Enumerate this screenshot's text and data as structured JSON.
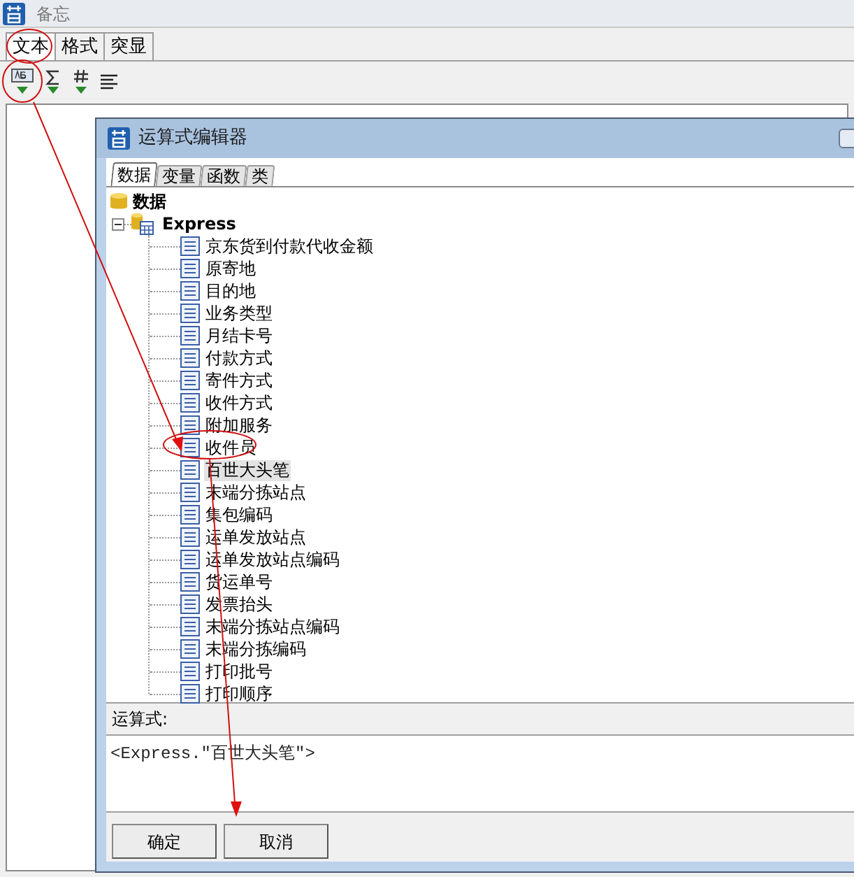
{
  "window": {
    "title": "备忘"
  },
  "tabs": [
    {
      "label": "文本",
      "selected": true
    },
    {
      "label": "格式",
      "selected": false
    },
    {
      "label": "突显",
      "selected": false
    }
  ],
  "dialog": {
    "title": "运算式编辑器",
    "tabs": [
      {
        "label": "数据",
        "selected": true
      },
      {
        "label": "变量",
        "selected": false
      },
      {
        "label": "函数",
        "selected": false
      },
      {
        "label": "类",
        "selected": false
      }
    ],
    "tree": {
      "label": "数据",
      "children": [
        {
          "label": "Express",
          "expanded": true,
          "children": [
            {
              "label": "京东货到付款代收金额",
              "selected": false
            },
            {
              "label": "原寄地",
              "selected": false
            },
            {
              "label": "目的地",
              "selected": false
            },
            {
              "label": "业务类型",
              "selected": false
            },
            {
              "label": "月结卡号",
              "selected": false
            },
            {
              "label": "付款方式",
              "selected": false
            },
            {
              "label": "寄件方式",
              "selected": false
            },
            {
              "label": "收件方式",
              "selected": false
            },
            {
              "label": "附加服务",
              "selected": false
            },
            {
              "label": "收件员",
              "selected": false
            },
            {
              "label": "百世大头笔",
              "selected": true
            },
            {
              "label": "末端分拣站点",
              "selected": false
            },
            {
              "label": "集包编码",
              "selected": false
            },
            {
              "label": "运单发放站点",
              "selected": false
            },
            {
              "label": "运单发放站点编码",
              "selected": false
            },
            {
              "label": "货运单号",
              "selected": false
            },
            {
              "label": "发票抬头",
              "selected": false
            },
            {
              "label": "末端分拣站点编码",
              "selected": false
            },
            {
              "label": "末端分拣编码",
              "selected": false
            },
            {
              "label": "打印批号",
              "selected": false
            },
            {
              "label": "打印顺序",
              "selected": false
            }
          ]
        }
      ]
    },
    "expression_label": "运算式:",
    "expression": "<Express.\"百世大头笔\">",
    "buttons": [
      "确定",
      "取消"
    ]
  }
}
